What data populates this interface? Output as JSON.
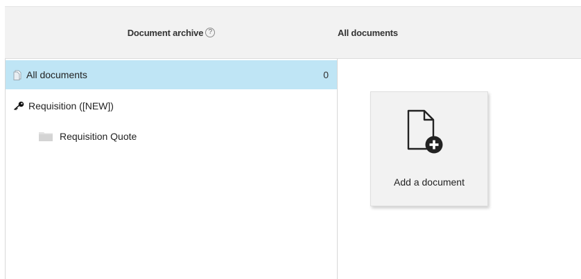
{
  "header": {
    "archive_title": "Document archive",
    "help_icon": "?",
    "right_title": "All documents"
  },
  "tree": {
    "items": [
      {
        "label": "All documents",
        "count": "0",
        "icon": "document-icon",
        "selected": true
      },
      {
        "label": "Requisition ([NEW])",
        "icon": "key-icon",
        "selected": false
      },
      {
        "label": "Requisition Quote",
        "icon": "folder-icon",
        "selected": false
      }
    ]
  },
  "main": {
    "add_document_label": "Add a document",
    "add_icon": "add-document-icon"
  },
  "colors": {
    "selected_row": "#bfe5f5",
    "header_bg": "#f2f2f2",
    "card_bg": "#f2f2f2"
  }
}
